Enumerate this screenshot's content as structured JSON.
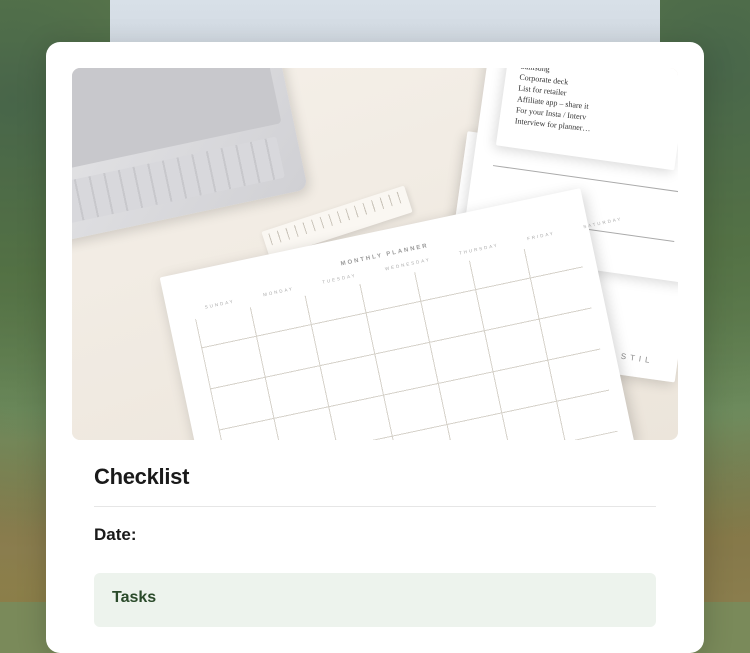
{
  "page": {
    "title": "Checklist",
    "date_label": "Date:"
  },
  "tasks": {
    "heading": "Tasks"
  },
  "hero": {
    "planner_title": "MONTHLY PLANNER",
    "planner_days": "SUNDAY MONDAY TUESDAY WEDNESDAY THURSDAY FRIDAY SATURDAY",
    "brand": "STIL"
  }
}
